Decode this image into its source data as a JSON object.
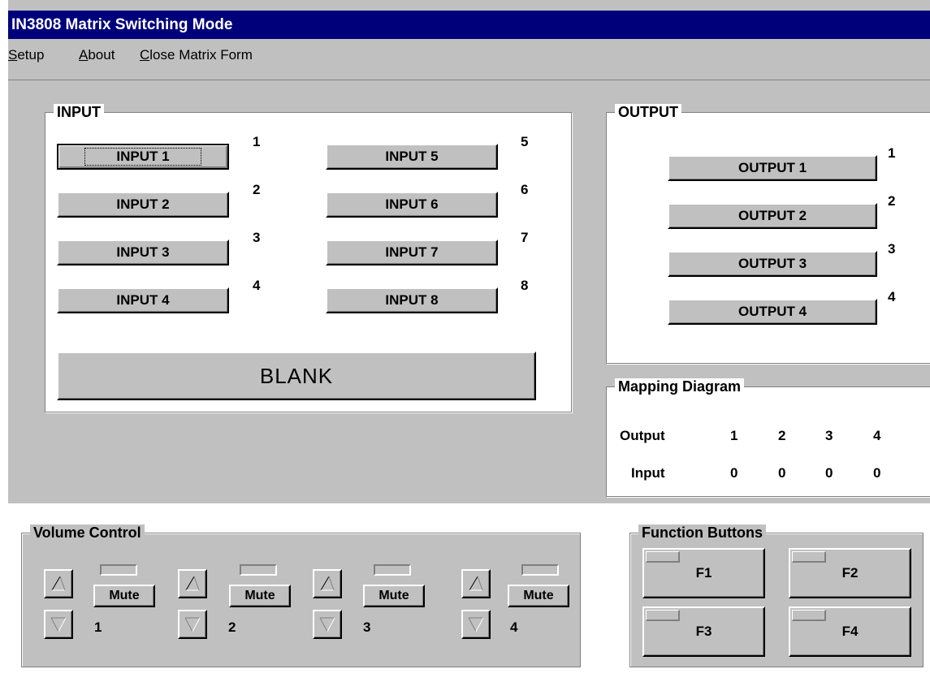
{
  "window": {
    "title": "IN3808 Matrix Switching Mode"
  },
  "menu": [
    {
      "key": "S",
      "rest": "etup"
    },
    {
      "key": "A",
      "rest": "bout"
    },
    {
      "key": "C",
      "rest": "lose Matrix Form"
    }
  ],
  "input_group": {
    "title": "INPUT",
    "buttons": [
      "INPUT 1",
      "INPUT 2",
      "INPUT 3",
      "INPUT 4",
      "INPUT 5",
      "INPUT 6",
      "INPUT 7",
      "INPUT 8"
    ],
    "numbers": [
      "1",
      "2",
      "3",
      "4",
      "5",
      "6",
      "7",
      "8"
    ],
    "blank_label": "BLANK"
  },
  "output_group": {
    "title": "OUTPUT",
    "buttons": [
      "OUTPUT 1",
      "OUTPUT 2",
      "OUTPUT 3",
      "OUTPUT 4"
    ],
    "numbers": [
      "1",
      "2",
      "3",
      "4"
    ]
  },
  "mapping": {
    "title": "Mapping Diagram",
    "output_label": "Output",
    "input_label": "Input",
    "outputs": [
      "1",
      "2",
      "3",
      "4"
    ],
    "inputs": [
      "0",
      "0",
      "0",
      "0"
    ]
  },
  "volume": {
    "title": "Volume Control",
    "mute_label": "Mute",
    "channels": [
      "1",
      "2",
      "3",
      "4"
    ]
  },
  "functions": {
    "title": "Function Buttons",
    "buttons": [
      "F1",
      "F2",
      "F3",
      "F4"
    ]
  }
}
